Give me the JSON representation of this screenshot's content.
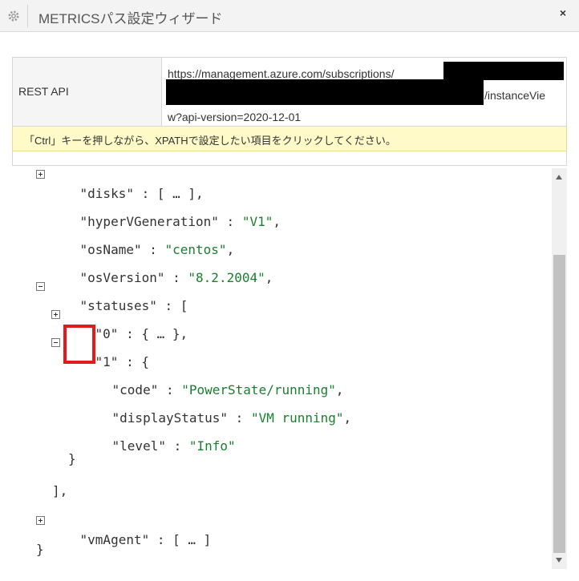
{
  "window": {
    "title": "METRICSパス設定ウィザード",
    "close_label": "×"
  },
  "api": {
    "label": "REST API",
    "url_line1": "https://management.azure.com/subscriptions/",
    "url_line2_tail": "/instanceVie",
    "url_line3": "w?api-version=2020-12-01"
  },
  "hint": "「Ctrl」キーを押しながら、XPATHで設定したい項目をクリックしてください。",
  "tree": {
    "disks_key": "\"disks\"",
    "disks_val": " : [ … ],",
    "hyperv_key": "\"hyperVGeneration\"",
    "hyperv_val": "\"V1\"",
    "osname_key": "\"osName\"",
    "osname_val": "\"centos\"",
    "osversion_key": "\"osVersion\"",
    "osversion_val": "\"8.2.2004\"",
    "statuses_key": "\"statuses\"",
    "statuses_open": " : [",
    "item0_key": "\"0\"",
    "item0_val": " : { … },",
    "item1_key": "\"1\"",
    "item1_open": " : {",
    "code_key": "\"code\"",
    "code_val": "\"PowerState/running\"",
    "display_key": "\"displayStatus\"",
    "display_val": "\"VM running\"",
    "level_key": "\"level\"",
    "level_val": "\"Info\"",
    "item1_close": "}",
    "statuses_close": "],",
    "vmagent_key": "\"vmAgent\"",
    "vmagent_val": " : [ … ]",
    "root_close": "}",
    "sep": " : ",
    "comma": ","
  },
  "colors": {
    "string_value": "#1a7f2e",
    "highlight": "#e01b1b"
  }
}
